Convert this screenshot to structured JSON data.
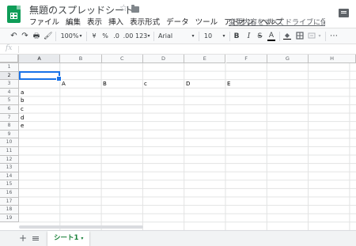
{
  "app": {
    "doc_title": "無題のスプレッドシート",
    "save_status": "変更内容をすべてドライブに保..."
  },
  "icons": {
    "star": "☆",
    "undo": "↶",
    "redo": "↷",
    "print": "🖶",
    "paint_format": "🖌",
    "more": "⋯"
  },
  "menu": [
    "ファイル",
    "編集",
    "表示",
    "挿入",
    "表示形式",
    "データ",
    "ツール",
    "アドオン",
    "ヘルプ"
  ],
  "toolbar": {
    "zoom": "100%",
    "currency": "¥",
    "percent": "%",
    "decrease_decimal": ".0",
    "increase_decimal": ".00",
    "format_more": "123",
    "font": "Arial",
    "font_size": "10",
    "bold": "B",
    "italic": "I",
    "strike": "S",
    "text_color": "A",
    "dropdown": "▾"
  },
  "formula_bar": {
    "fx": "fx",
    "value": ""
  },
  "columns": [
    "A",
    "B",
    "C",
    "D",
    "E",
    "F",
    "G",
    "H"
  ],
  "rows": [
    "1",
    "2",
    "3",
    "4",
    "5",
    "6",
    "7",
    "8",
    "9",
    "10",
    "11",
    "12",
    "13",
    "14",
    "15",
    "16",
    "17",
    "18",
    "19"
  ],
  "cells": {
    "B3": "A",
    "C3": "B",
    "D3": "c",
    "E3": "D",
    "F3": "E",
    "A4": "a",
    "A5": "b",
    "A6": "c",
    "A7": "d",
    "A8": "e"
  },
  "selected_cell": "A2",
  "sheets": [
    {
      "label": "シート1",
      "active": true
    }
  ],
  "colors": {
    "brand": "#0f9d58",
    "selection": "#1a73e8",
    "active_tab": "#188038"
  }
}
